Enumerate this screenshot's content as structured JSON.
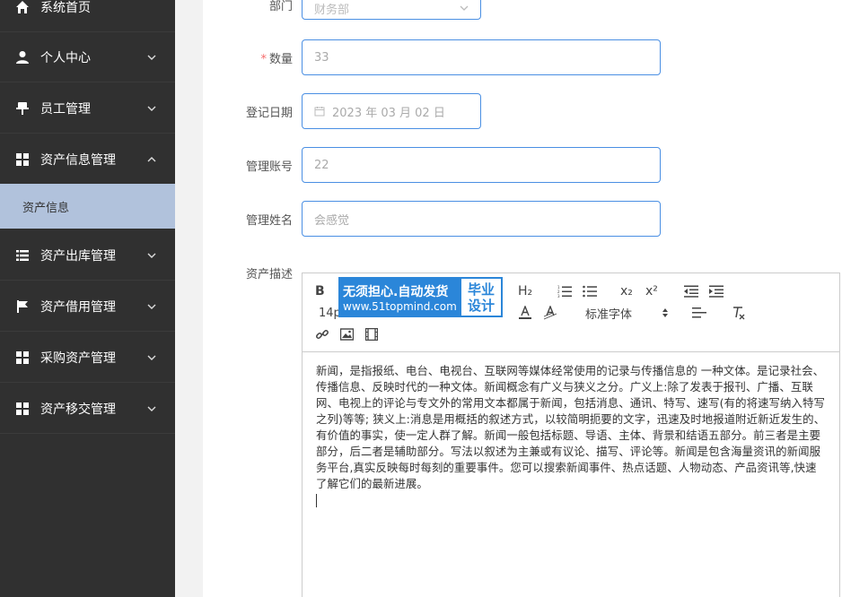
{
  "sidebar": {
    "items": [
      {
        "label": "系统首页",
        "icon": "home-icon"
      },
      {
        "label": "个人中心",
        "icon": "user-icon"
      },
      {
        "label": "员工管理",
        "icon": "pin-icon"
      },
      {
        "label": "资产信息管理",
        "icon": "grid-icon",
        "expanded": true
      },
      {
        "label": "资产出库管理",
        "icon": "list-icon"
      },
      {
        "label": "资产借用管理",
        "icon": "flag-icon"
      },
      {
        "label": "采购资产管理",
        "icon": "grid-icon"
      },
      {
        "label": "资产移交管理",
        "icon": "grid-icon"
      }
    ],
    "sub_item": "资产信息"
  },
  "form": {
    "department": {
      "label": "部门",
      "value": "财务部"
    },
    "quantity": {
      "label": "数量",
      "value": "33"
    },
    "date": {
      "label": "登记日期",
      "value": "2023 年 03 月 02 日"
    },
    "account": {
      "label": "管理账号",
      "value": "22"
    },
    "name": {
      "label": "管理姓名",
      "value": "会感觉"
    },
    "description": {
      "label": "资产描述"
    }
  },
  "editor": {
    "bold": "B",
    "h2": "H₂",
    "sub": "x₂",
    "sup": "x²",
    "font_size": "14p",
    "font_family": "标准字体",
    "content": "新闻，是指报纸、电台、电视台、互联网等媒体经常使用的记录与传播信息的 一种文体。是记录社会、传播信息、反映时代的一种文体。新闻概念有广义与狭义之分。广义上:除了发表于报刊、广播、互联网、电视上的评论与专文外的常用文本都属于新闻，包括消息、通讯、特写、速写(有的将速写纳入特写之列)等等; 狭义上:消息是用概括的叙述方式，以较简明扼要的文字，迅速及时地报道附近新近发生的、有价值的事实，使一定人群了解。新闻一般包括标题、导语、主体、背景和结语五部分。前三者是主要部分，后二者是辅助部分。写法以叙述为主兼或有议论、描写、评论等。新闻是包含海量资讯的新闻服务平台,真实反映每时每刻的重要事件。您可以搜索新闻事件、热点话题、人物动态、产品资讯等,快速了解它们的最新进展。"
  },
  "watermark": {
    "line1": "无须担心.自动发货",
    "line2": "www.51topmind.com",
    "right1": "毕业",
    "right2": "设计"
  }
}
